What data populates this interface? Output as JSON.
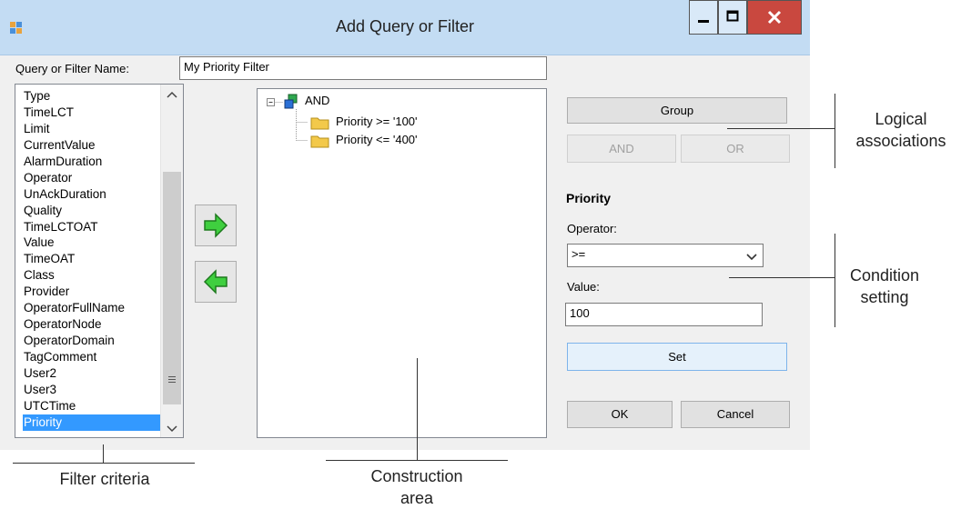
{
  "window": {
    "title": "Add Query or Filter",
    "name_label": "Query or Filter Name:",
    "name_value": "My Priority Filter"
  },
  "criteria_list": {
    "items": [
      "Type",
      "TimeLCT",
      "Limit",
      "CurrentValue",
      "AlarmDuration",
      "Operator",
      "UnAckDuration",
      "Quality",
      "TimeLCTOAT",
      "Value",
      "TimeOAT",
      "Class",
      "Provider",
      "OperatorFullName",
      "OperatorNode",
      "OperatorDomain",
      "TagComment",
      "User2",
      "User3",
      "UTCTime",
      "Priority"
    ],
    "selected": "Priority"
  },
  "tree": {
    "root": "AND",
    "children": [
      "Priority >= '100'",
      "Priority <= '400'"
    ]
  },
  "buttons": {
    "group": "Group",
    "and": "AND",
    "or": "OR",
    "set": "Set",
    "ok": "OK",
    "cancel": "Cancel"
  },
  "condition": {
    "heading": "Priority",
    "operator_label": "Operator:",
    "operator_value": ">=",
    "value_label": "Value:",
    "value": "100"
  },
  "callouts": {
    "logical": "Logical\nassociations",
    "condition": "Condition\nsetting",
    "filter": "Filter criteria",
    "construction": "Construction\narea"
  },
  "colors": {
    "titlebar": "#c3dcf3",
    "selection": "#3399ff",
    "close_button": "#c9483f",
    "arrow_green": "#33cc33"
  }
}
